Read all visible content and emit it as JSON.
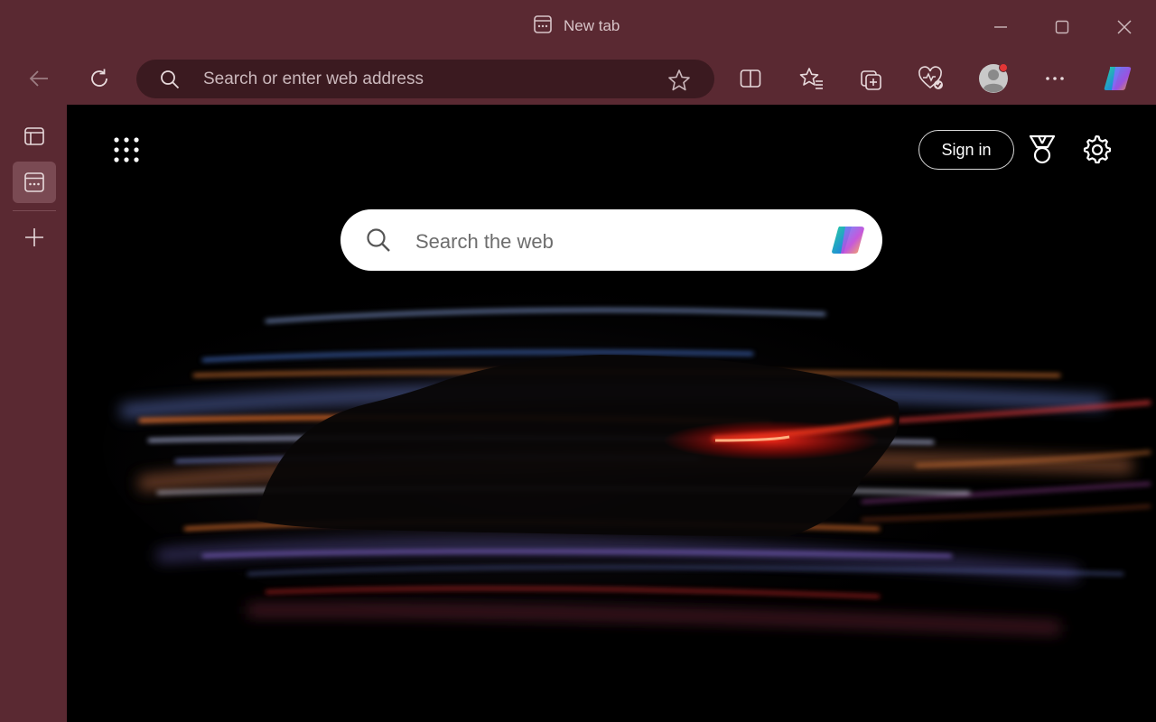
{
  "window": {
    "tab_title": "New tab"
  },
  "toolbar": {
    "address_placeholder": "Search or enter web address"
  },
  "page": {
    "search_placeholder": "Search the web",
    "sign_in_label": "Sign in"
  },
  "colors": {
    "frame": "#5a2932",
    "address_bar": "#3b1a20",
    "page_background": "#000000",
    "notification_dot": "#e23636"
  }
}
